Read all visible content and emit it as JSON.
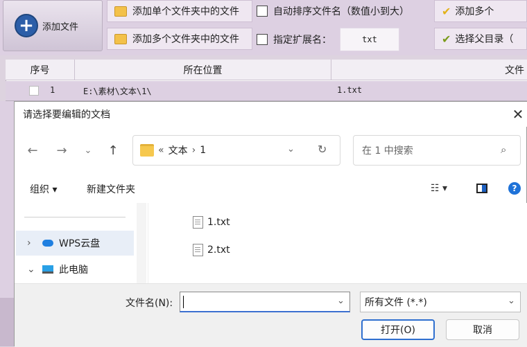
{
  "app": {
    "toolbar": {
      "add_file_label": "添加文件",
      "add_single_folder_label": "添加单个文件夹中的文件",
      "add_multi_folder_label": "添加多个文件夹中的文件",
      "auto_sort_label": "自动排序文件名（数值小到大）",
      "specify_ext_label": "指定扩展名：",
      "ext_value": "txt",
      "add_multi_truncated_label": "添加多个",
      "select_parent_label": "选择父目录（"
    },
    "grid": {
      "columns": [
        "序号",
        "所在位置",
        "文件"
      ],
      "rows": [
        {
          "index": "1",
          "location": "E:\\素材\\文本\\1\\",
          "name": "1.txt"
        }
      ]
    }
  },
  "dialog": {
    "title": "请选择要编辑的文档",
    "breadcrumb": {
      "overflow": "«",
      "parts": [
        "文本",
        "1"
      ]
    },
    "search_placeholder": "在 1 中搜索",
    "commands": {
      "organize": "组织 ▾",
      "new_folder": "新建文件夹"
    },
    "tree": [
      {
        "label": "WPS云盘",
        "chevron": "›"
      },
      {
        "label": "此电脑",
        "chevron": "⌄"
      }
    ],
    "files": [
      "1.txt",
      "2.txt"
    ],
    "filename_label": "文件名(N):",
    "filename_value": "",
    "filetype_value": "所有文件 (*.*)",
    "open_label": "打开(O)",
    "cancel_label": "取消"
  }
}
